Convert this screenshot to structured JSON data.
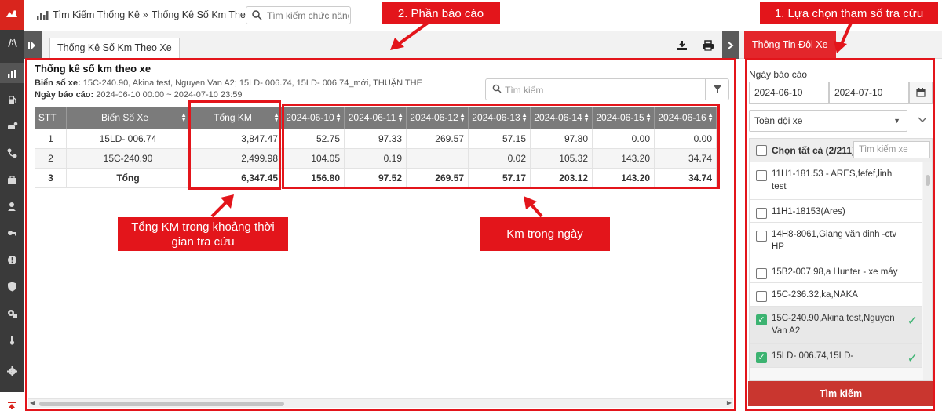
{
  "sidebar": {
    "logo_icon": "logo-icon",
    "items": [
      {
        "icon": "road-icon"
      },
      {
        "icon": "chart-icon",
        "active": true
      },
      {
        "icon": "fuel-icon"
      },
      {
        "icon": "car-settings-icon"
      },
      {
        "icon": "route-icon"
      },
      {
        "icon": "briefcase-icon"
      },
      {
        "icon": "driver-icon"
      },
      {
        "icon": "key-icon"
      },
      {
        "icon": "alert-icon"
      },
      {
        "icon": "shield-icon"
      },
      {
        "icon": "gear-car-icon"
      },
      {
        "icon": "thermometer-icon"
      },
      {
        "icon": "gear-icon"
      }
    ],
    "bottom_icon": "scroll-top-icon"
  },
  "topbar": {
    "breadcrumb": [
      "Tìm Kiếm Thống Kê",
      "Thống Kê Số Km Theo Xe"
    ],
    "separator": "»",
    "function_search_placeholder": "Tìm kiếm chức năng"
  },
  "tabbar": {
    "tab_label": "Thống Kê Số Km Theo Xe"
  },
  "report": {
    "title": "Thống kê số km theo xe",
    "plates_label": "Biển số xe:",
    "plates_value": "15C-240.90, Akina test, Nguyen Van A2; 15LD- 006.74, 15LD- 006.74_mới, THUẬN THE",
    "date_label": "Ngày báo cáo:",
    "date_value": "2024-06-10 00:00 ~ 2024-07-10 23:59",
    "search_placeholder": "Tìm kiếm",
    "columns": [
      "STT",
      "Biển Số Xe",
      "Tổng KM",
      "2024-06-10",
      "2024-06-11",
      "2024-06-12",
      "2024-06-13",
      "2024-06-14",
      "2024-06-15",
      "2024-06-16"
    ],
    "rows": [
      [
        "1",
        "15LD- 006.74",
        "3,847.47",
        "52.75",
        "97.33",
        "269.57",
        "57.15",
        "97.80",
        "0.00",
        "0.00"
      ],
      [
        "2",
        "15C-240.90",
        "2,499.98",
        "104.05",
        "0.19",
        "",
        "0.02",
        "105.32",
        "143.20",
        "34.74"
      ],
      [
        "3",
        "Tổng",
        "6,347.45",
        "156.80",
        "97.52",
        "269.57",
        "57.17",
        "203.12",
        "143.20",
        "34.74"
      ]
    ]
  },
  "right_panel": {
    "tab_label": "Thông Tin Đội Xe",
    "date_label": "Ngày báo cáo",
    "date_from": "2024-06-10",
    "date_to": "2024-07-10",
    "fleet_selected": "Toàn đội xe",
    "select_all_label": "Chọn tất cả (2/211)",
    "vehicle_search_placeholder": "Tìm kiếm xe",
    "vehicles": [
      {
        "label": "11H1-181.53 - ARES,fefef,linh test",
        "checked": false
      },
      {
        "label": "11H1-18153(Ares)",
        "checked": false
      },
      {
        "label": "14H8-8061,Giang văn định -ctv HP",
        "checked": false
      },
      {
        "label": "15B2-007.98,a Hunter - xe máy",
        "checked": false
      },
      {
        "label": "15C-236.32,ka,NAKA",
        "checked": false
      },
      {
        "label": "15C-240.90,Akina test,Nguyen Van A2",
        "checked": true
      },
      {
        "label": "15LD- 006.74,15LD-",
        "checked": true
      }
    ],
    "search_button": "Tìm kiếm"
  },
  "annotations": {
    "label_report": "2. Phần báo cáo",
    "label_params": "1. Lựa chọn tham số tra cứu",
    "label_total": "Tổng KM trong khoảng thời gian tra cứu",
    "label_daily": "Km trong ngày",
    "color": "#e3151b"
  },
  "colors": {
    "accent": "#e3262b",
    "sidebar_bg": "#3a3a3a",
    "table_header": "#7b7b7b",
    "check_green": "#3cb371"
  }
}
